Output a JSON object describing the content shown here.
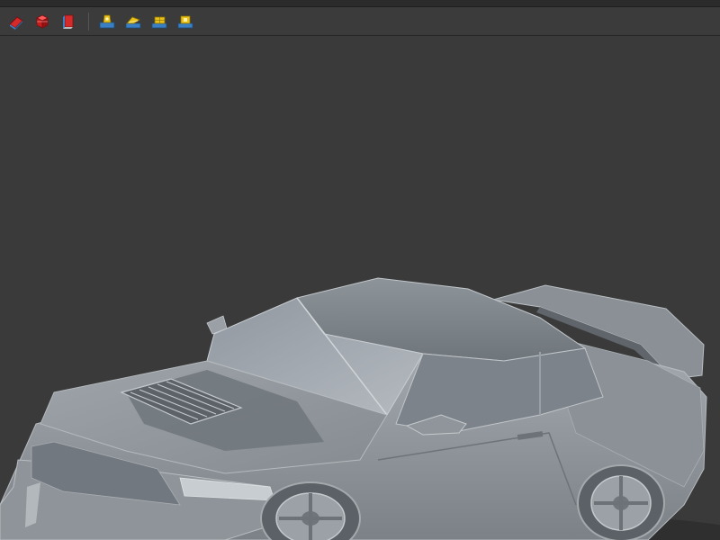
{
  "toolbar": {
    "buttons": [
      {
        "icon": "red-eraser-icon",
        "tooltip": ""
      },
      {
        "icon": "red-box-icon",
        "tooltip": ""
      },
      {
        "icon": "red-book-icon",
        "tooltip": ""
      },
      {
        "icon": "yellow-tool-1-icon",
        "tooltip": ""
      },
      {
        "icon": "yellow-tool-2-icon",
        "tooltip": ""
      },
      {
        "icon": "yellow-tool-3-icon",
        "tooltip": ""
      },
      {
        "icon": "yellow-tool-4-icon",
        "tooltip": ""
      }
    ]
  },
  "viewport": {
    "background_color": "#3a3a3a",
    "model_name": ""
  },
  "colors": {
    "accent_red": "#d42a2a",
    "accent_yellow": "#e8c21a",
    "accent_blue": "#3a7fc4",
    "model_gray": "#9aa0a5"
  }
}
